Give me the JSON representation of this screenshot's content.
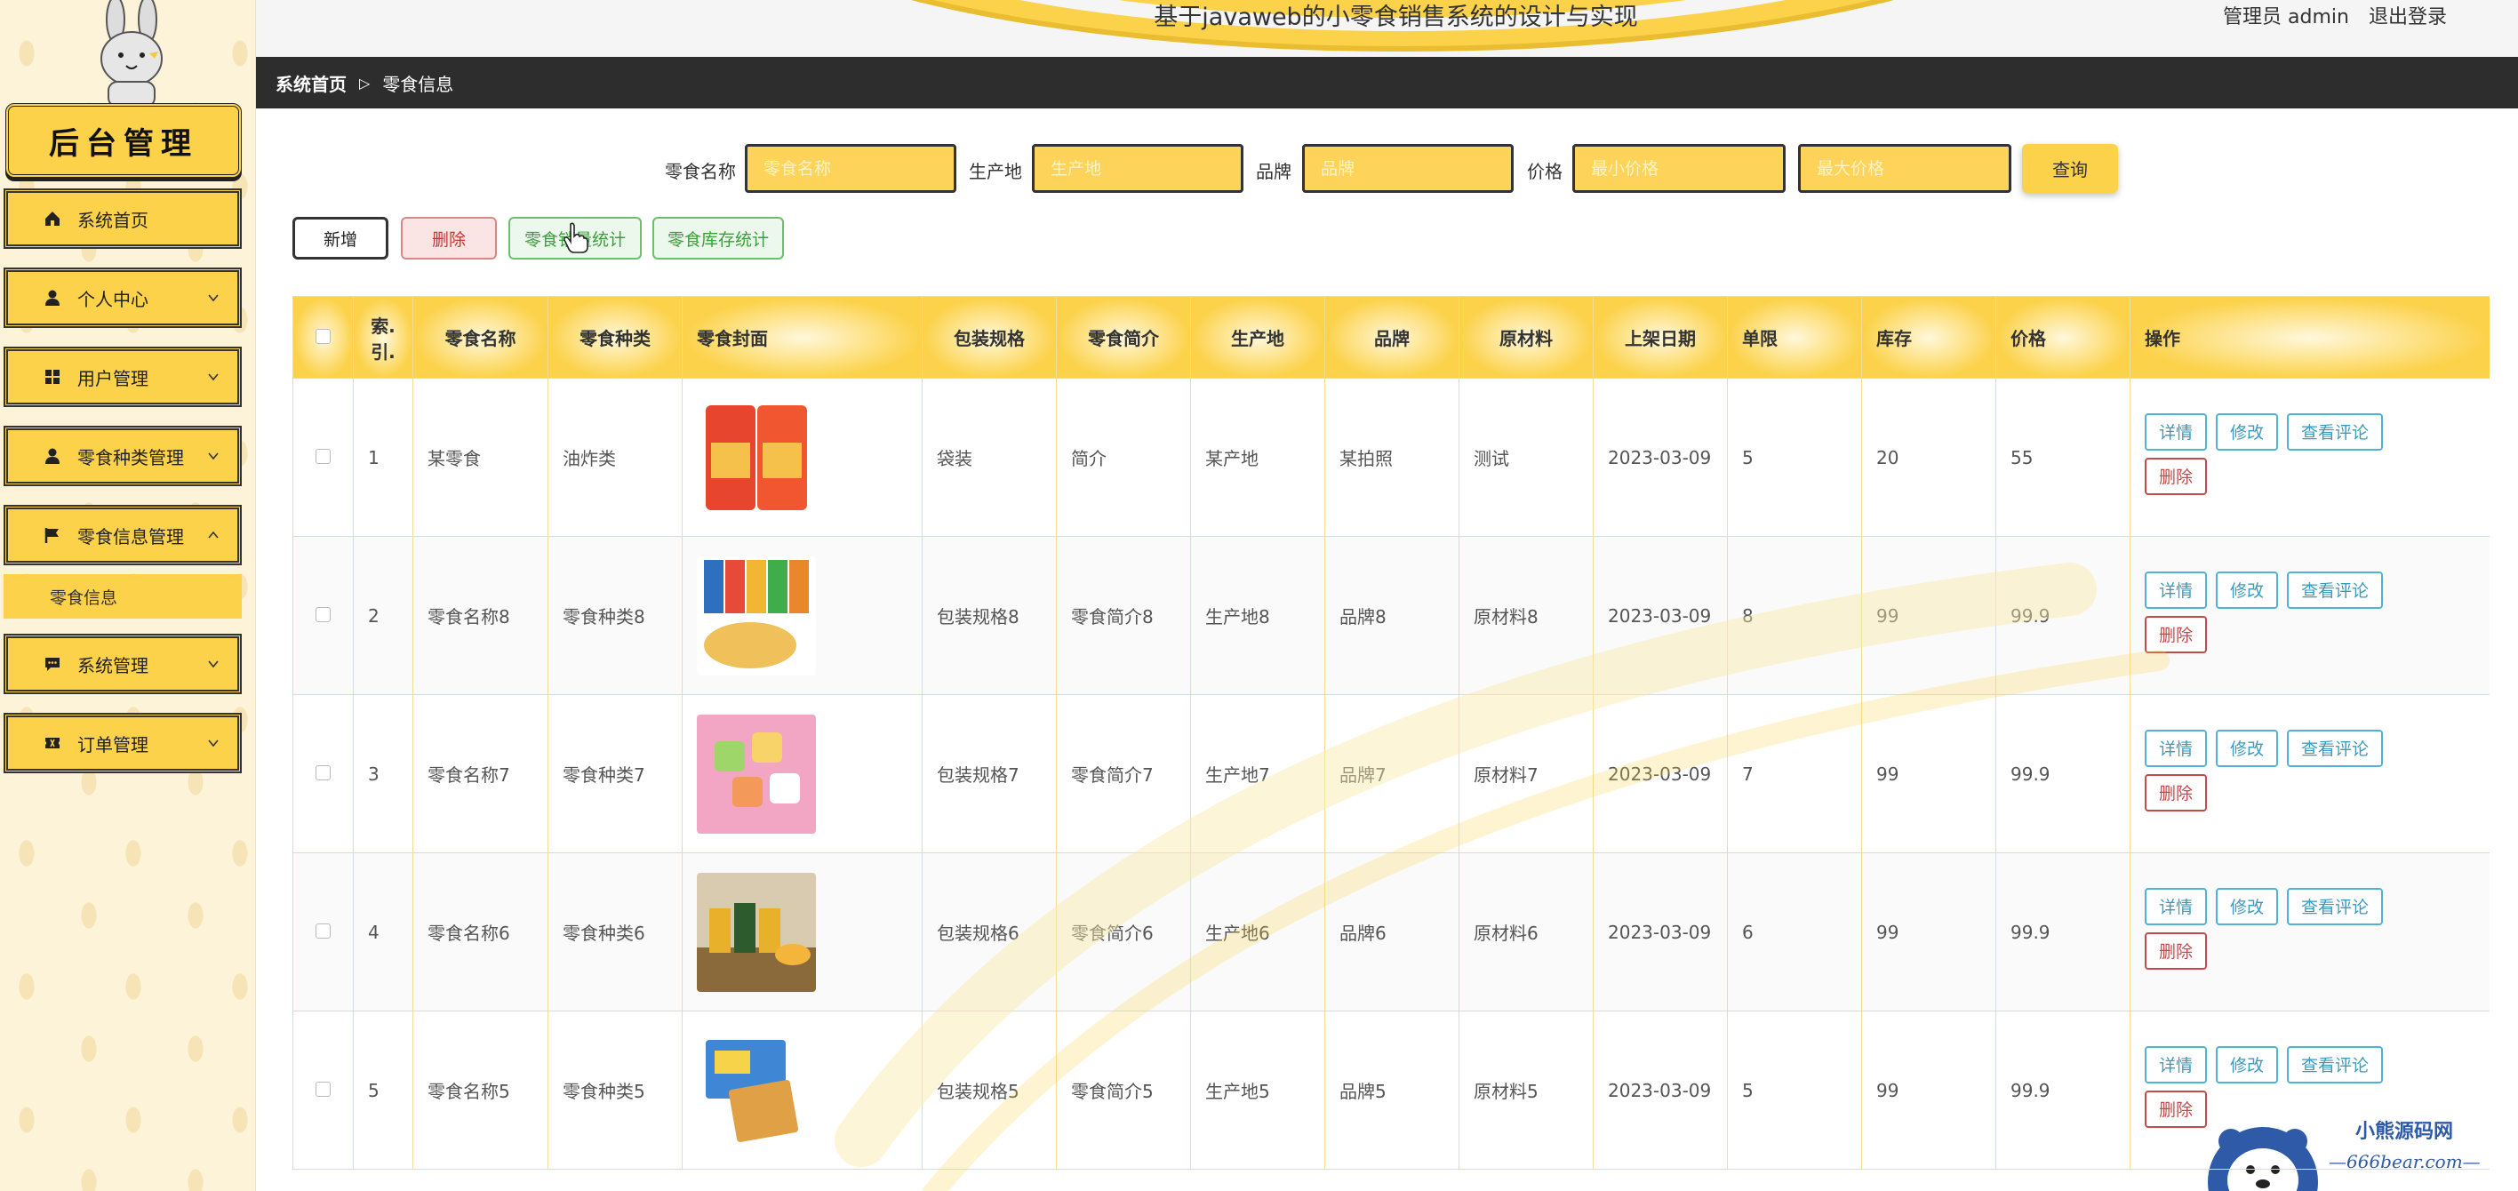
{
  "header": {
    "title": "基于javaweb的小零食销售系统的设计与实现",
    "user_label": "管理员 admin",
    "logout_label": "退出登录"
  },
  "sidebar": {
    "brand": "后台管理",
    "items": [
      {
        "label": "系统首页",
        "icon": "home-icon"
      },
      {
        "label": "个人中心",
        "icon": "user-icon"
      },
      {
        "label": "用户管理",
        "icon": "grid-icon"
      },
      {
        "label": "零食种类管理",
        "icon": "user-icon"
      },
      {
        "label": "零食信息管理",
        "icon": "flag-icon"
      },
      {
        "label": "系统管理",
        "icon": "chat-icon"
      },
      {
        "label": "订单管理",
        "icon": "ticket-icon"
      }
    ],
    "submenu": {
      "label": "零食信息"
    }
  },
  "breadcrumb": {
    "home": "系统首页",
    "separator": "▷",
    "current": "零食信息"
  },
  "search": {
    "name_label": "零食名称",
    "name_placeholder": "零食名称",
    "origin_label": "生产地",
    "origin_placeholder": "生产地",
    "brand_label": "品牌",
    "brand_placeholder": "品牌",
    "price_label": "价格",
    "min_price_placeholder": "最小价格",
    "max_price_placeholder": "最大价格",
    "button": "查询"
  },
  "actions": {
    "add": "新增",
    "delete": "删除",
    "sales_stats": "零食销量统计",
    "stock_stats": "零食库存统计"
  },
  "table": {
    "headers": [
      "索引",
      "零食名称",
      "零食种类",
      "零食封面",
      "包装规格",
      "零食简介",
      "生产地",
      "品牌",
      "原材料",
      "上架日期",
      "单限",
      "库存",
      "价格",
      "操作"
    ],
    "index_header_line1": "索.",
    "index_header_line2": "引.",
    "rows": [
      {
        "index": "1",
        "name": "某零食",
        "category": "油炸类",
        "packaging": "袋装",
        "intro": "简介",
        "origin": "某产地",
        "brand": "某拍照",
        "material": "测试",
        "date": "2023-03-09",
        "limit": "5",
        "stock": "20",
        "price": "55"
      },
      {
        "index": "2",
        "name": "零食名称8",
        "category": "零食种类8",
        "packaging": "包装规格8",
        "intro": "零食简介8",
        "origin": "生产地8",
        "brand": "品牌8",
        "material": "原材料8",
        "date": "2023-03-09",
        "limit": "8",
        "stock": "99",
        "price": "99.9"
      },
      {
        "index": "3",
        "name": "零食名称7",
        "category": "零食种类7",
        "packaging": "包装规格7",
        "intro": "零食简介7",
        "origin": "生产地7",
        "brand": "品牌7",
        "material": "原材料7",
        "date": "2023-03-09",
        "limit": "7",
        "stock": "99",
        "price": "99.9"
      },
      {
        "index": "4",
        "name": "零食名称6",
        "category": "零食种类6",
        "packaging": "包装规格6",
        "intro": "零食简介6",
        "origin": "生产地6",
        "brand": "品牌6",
        "material": "原材料6",
        "date": "2023-03-09",
        "limit": "6",
        "stock": "99",
        "price": "99.9"
      },
      {
        "index": "5",
        "name": "零食名称5",
        "category": "零食种类5",
        "packaging": "包装规格5",
        "intro": "零食简介5",
        "origin": "生产地5",
        "brand": "品牌5",
        "material": "原材料5",
        "date": "2023-03-09",
        "limit": "5",
        "stock": "99",
        "price": "99.9"
      }
    ],
    "row_actions": {
      "detail": "详情",
      "edit": "修改",
      "comments": "查看评论",
      "delete": "删除"
    }
  },
  "watermark": {
    "name": "小熊源码网",
    "url": "—666bear.com—"
  },
  "colors": {
    "accent": "#fcd24a",
    "dark_bar": "#2d2d2d",
    "link_blue": "#3a9ac0",
    "danger": "#c24a4a",
    "success": "#3a9e3a"
  }
}
